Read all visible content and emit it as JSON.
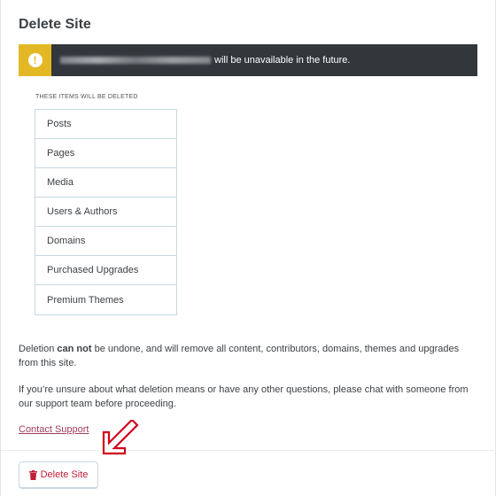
{
  "page": {
    "title": "Delete Site"
  },
  "notice": {
    "text": "will be unavailable in the future.",
    "icon": "alert-icon",
    "icon_glyph": "!",
    "colors": {
      "bar": "#32373c",
      "icon_bg": "#e4b824"
    }
  },
  "deleted_items": {
    "heading": "THESE ITEMS WILL BE DELETED",
    "items": [
      "Posts",
      "Pages",
      "Media",
      "Users & Authors",
      "Domains",
      "Purchased Upgrades",
      "Premium Themes"
    ]
  },
  "warning": {
    "prefix": "Deletion ",
    "bold": "can not",
    "suffix": " be undone, and will remove all content, contributors, domains, themes and upgrades from this site."
  },
  "help": {
    "text": "If you’re unsure about what deletion means or have any other questions, please chat with someone from our support team before proceeding.",
    "link_label": "Contact Support"
  },
  "actions": {
    "delete_label": "Delete Site",
    "delete_icon": "trash-icon",
    "accent_color": "#c1203a"
  },
  "annotation": {
    "arrow_color": "#d0021b"
  }
}
